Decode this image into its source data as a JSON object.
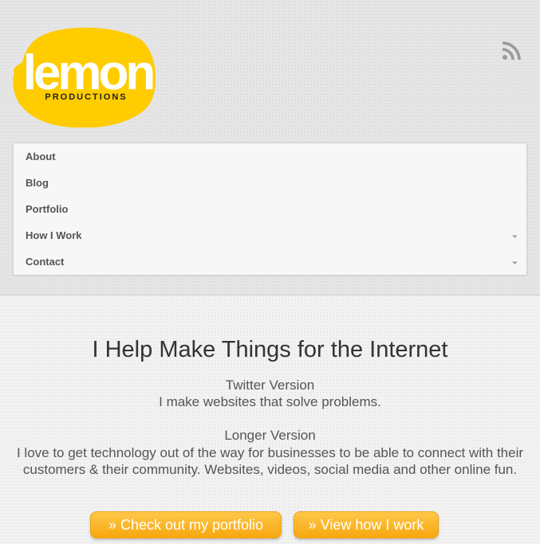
{
  "logo": {
    "word": "lemon",
    "tagline": "PRODUCTIONS"
  },
  "nav": {
    "items": [
      {
        "label": "About",
        "has_submenu": false
      },
      {
        "label": "Blog",
        "has_submenu": false
      },
      {
        "label": "Portfolio",
        "has_submenu": false
      },
      {
        "label": "How I Work",
        "has_submenu": true
      },
      {
        "label": "Contact",
        "has_submenu": true
      }
    ]
  },
  "main": {
    "headline": "I Help Make Things for the Internet",
    "twitter_title": "Twitter Version",
    "twitter_text": "I make websites that solve problems.",
    "longer_title": "Longer Version",
    "longer_text": "I love to get technology out of the way for businesses to be able to connect with their customers & their community. Websites, videos, social media and other online fun.",
    "buttons": {
      "portfolio": "» Check out my portfolio",
      "how": "» View how I work"
    }
  },
  "colors": {
    "brand_yellow": "#ffcc00",
    "button_orange": "#f7a70f"
  },
  "icons": {
    "feed": "rss-icon",
    "submenu": "chevron-down-icon"
  }
}
